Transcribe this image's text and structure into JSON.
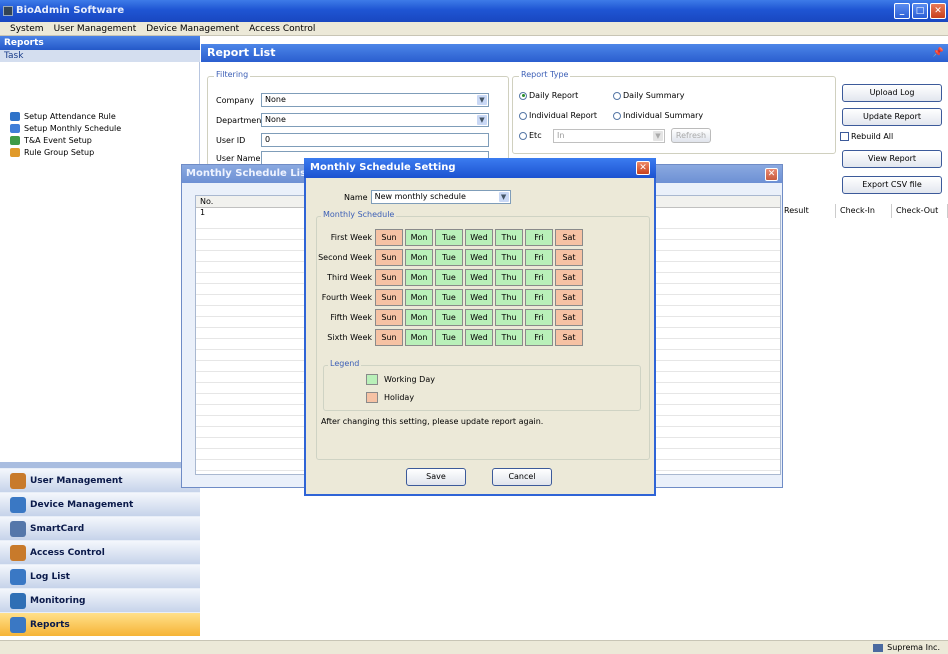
{
  "app": {
    "title": "BioAdmin Software"
  },
  "menu": [
    "System",
    "User Management",
    "Device Management",
    "Access Control"
  ],
  "left": {
    "header": "Reports",
    "task_label": "Task",
    "tasks": [
      {
        "label": "Setup Attendance Rule",
        "icon": "attendance-rule-icon"
      },
      {
        "label": "Setup Monthly Schedule",
        "icon": "calendar-icon"
      },
      {
        "label": "T&A Event Setup",
        "icon": "event-icon"
      },
      {
        "label": "Rule Group Setup",
        "icon": "rule-group-icon"
      }
    ],
    "nav": [
      {
        "label": "User Management",
        "icon": "users-icon",
        "color": "#c87a2b"
      },
      {
        "label": "Device Management",
        "icon": "device-icon",
        "color": "#3a78c4"
      },
      {
        "label": "SmartCard",
        "icon": "smartcard-icon",
        "color": "#5577aa"
      },
      {
        "label": "Access Control",
        "icon": "access-icon",
        "color": "#c87a2b"
      },
      {
        "label": "Log List",
        "icon": "log-icon",
        "color": "#3a78c4"
      },
      {
        "label": "Monitoring",
        "icon": "monitoring-icon",
        "color": "#2f6fb5"
      },
      {
        "label": "Reports",
        "icon": "reports-icon",
        "color": "#3a78c4"
      }
    ]
  },
  "report": {
    "title": "Report List",
    "filtering": {
      "legend": "Filtering",
      "company_label": "Company",
      "company_value": "None",
      "department_label": "Department",
      "department_value": "None",
      "userid_label": "User ID",
      "userid_value": "0",
      "username_label": "User Name"
    },
    "type": {
      "legend": "Report Type",
      "daily_report": "Daily Report",
      "daily_summary": "Daily Summary",
      "individual_report": "Individual Report",
      "individual_summary": "Individual Summary",
      "etc": "Etc",
      "etc_value": "In",
      "refresh": "Refresh"
    },
    "buttons": {
      "upload": "Upload Log",
      "update": "Update Report",
      "rebuild": "Rebuild All",
      "view": "View Report",
      "export": "Export CSV file"
    },
    "columns": [
      "Result",
      "Check-In",
      "Check-Out"
    ]
  },
  "monthly_list": {
    "title": "Monthly Schedule List",
    "col_no": "No.",
    "row1": "1"
  },
  "dialog": {
    "title": "Monthly Schedule Setting",
    "name_label": "Name",
    "name_value": "New monthly schedule",
    "group_label": "Monthly Schedule",
    "weeks": [
      "First Week",
      "Second Week",
      "Third Week",
      "Fourth Week",
      "Fifth Week",
      "Sixth Week"
    ],
    "days": [
      "Sun",
      "Mon",
      "Tue",
      "Wed",
      "Thu",
      "Fri",
      "Sat"
    ],
    "legend_label": "Legend",
    "working_day": "Working Day",
    "holiday": "Holiday",
    "note": "After changing this setting, please update report again.",
    "save": "Save",
    "cancel": "Cancel",
    "colors": {
      "working": "#b9f0b9",
      "holiday": "#f6c2a4"
    }
  },
  "status": {
    "company": "Suprema Inc."
  }
}
